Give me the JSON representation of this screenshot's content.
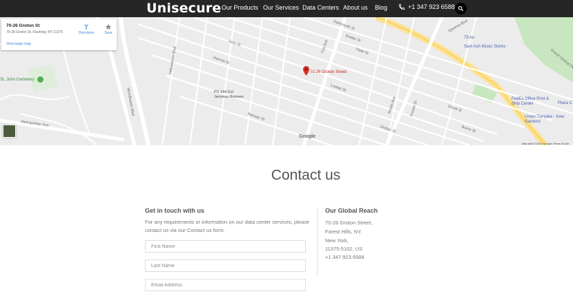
{
  "header": {
    "logo": "Unisecure",
    "nav": [
      {
        "label": "Our Products"
      },
      {
        "label": "Our Services"
      },
      {
        "label": "Data Centers"
      },
      {
        "label": "About us"
      },
      {
        "label": "Blog"
      }
    ],
    "phone": "+1 347 923 6588",
    "icons": {
      "phone": "phone-icon",
      "search": "search-icon"
    }
  },
  "map": {
    "card": {
      "title": "70-26 Groton St",
      "address": "70-26 Groton St, Flushing, NY 11375",
      "directions": "Directions",
      "save": "Save",
      "larger_map": "View larger map"
    },
    "pin_label": "70-26 Groton Street",
    "pois": {
      "cemetery": "St. John Cemetery",
      "school": "PS 144 Col Jeromus Remsen",
      "music": "Sam Ash Music Stores",
      "fedex": "FedEx Office Print & Ship Center",
      "union": "Union Turnpike - Kew Gardens",
      "plaza": "Plaza C",
      "grand": "Grand Central Pkwy",
      "queens_blvd": "Queens Blvd",
      "ave75": "75 Av"
    },
    "streets": {
      "s1": "Dartmouth St",
      "s2": "Exeter St",
      "s3": "Fleet St",
      "s4": "Harrow St",
      "s5": "Juno St",
      "s6": "Loubet St",
      "s7": "Nansen St",
      "s8": "Woodhaven Blvd",
      "s9": "Yellowstone Blvd",
      "s10": "71st Ave",
      "s11": "Ascan Ave",
      "s12": "Kessel St",
      "s13": "Groton St",
      "s14": "Metropolitan Ave",
      "s15": "Olcott St",
      "s16": "Burns St"
    },
    "google": "Google",
    "footer": "Map data ©2018 Google   Terms of Use",
    "colors": {
      "pin": "#d93025",
      "park": "#c8e6c0",
      "highway": "#fde293"
    }
  },
  "contact": {
    "title": "Contact us",
    "left_head": "Get in touch with us",
    "intro": "For any requirements or information on our data center services, please contact us via our Contact us form.",
    "fields": {
      "first_name": "First Name",
      "last_name": "Last Name",
      "email": "Email Address"
    },
    "right_head": "Our Global Reach",
    "address_lines": [
      "70-26 Groton Street,",
      "Forest Hills, NY,",
      "New York,",
      "11375-5102, US",
      "+1 347 923 6588"
    ]
  }
}
